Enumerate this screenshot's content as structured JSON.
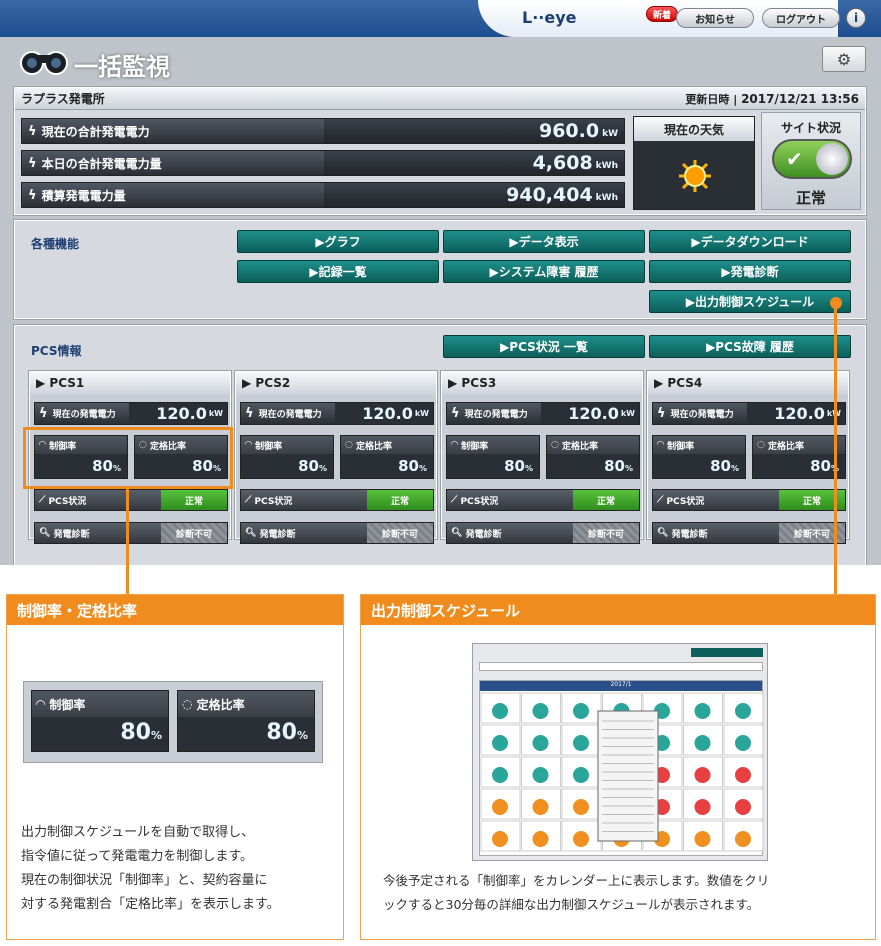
{
  "header": {
    "logo": "L··eye",
    "new_badge": "新着",
    "notice": "お知らせ",
    "logout": "ログアウト",
    "info": "i"
  },
  "page": {
    "title": "一括監視",
    "gear": "⚙"
  },
  "plant": {
    "name": "ラプラス発電所",
    "updated_label": "更新日時",
    "updated_value": "2017/12/21 13:56",
    "metrics": [
      {
        "label": "現在の合計発電電力",
        "value": "960.0",
        "unit": "kW"
      },
      {
        "label": "本日の合計発電電力量",
        "value": "4,608",
        "unit": "kWh"
      },
      {
        "label": "積算発電電力量",
        "value": "940,404",
        "unit": "kWh"
      }
    ],
    "weather_label": "現在の天気",
    "site_label": "サイト状況",
    "site_status": "正常"
  },
  "functions": {
    "label": "各種機能",
    "buttons": [
      "▶グラフ",
      "▶データ表示",
      "▶データダウンロード",
      "▶記録一覧",
      "▶システム障害 履歴",
      "▶発電診断",
      "▶出力制御スケジュール"
    ]
  },
  "pcs": {
    "label": "PCS情報",
    "btn_status": "▶PCS状況 一覧",
    "btn_fault": "▶PCS故障 履歴",
    "units": [
      {
        "name": "▶ PCS1",
        "power_label": "現在の発電電力",
        "power": "120.0",
        "unit": "kW",
        "ctrl_label": "制御率",
        "ctrl": "80",
        "rated_label": "定格比率",
        "rated": "80",
        "pct": "%",
        "status_label": "PCS状況",
        "status": "正常",
        "diag_label": "発電診断",
        "diag": "診断不可"
      },
      {
        "name": "▶ PCS2",
        "power_label": "現在の発電電力",
        "power": "120.0",
        "unit": "kW",
        "ctrl_label": "制御率",
        "ctrl": "80",
        "rated_label": "定格比率",
        "rated": "80",
        "pct": "%",
        "status_label": "PCS状況",
        "status": "正常",
        "diag_label": "発電診断",
        "diag": "診断不可"
      },
      {
        "name": "▶ PCS3",
        "power_label": "現在の発電電力",
        "power": "120.0",
        "unit": "kW",
        "ctrl_label": "制御率",
        "ctrl": "80",
        "rated_label": "定格比率",
        "rated": "80",
        "pct": "%",
        "status_label": "PCS状況",
        "status": "正常",
        "diag_label": "発電診断",
        "diag": "診断不可"
      },
      {
        "name": "▶ PCS4",
        "power_label": "現在の発電電力",
        "power": "120.0",
        "unit": "kW",
        "ctrl_label": "制御率",
        "ctrl": "80",
        "rated_label": "定格比率",
        "rated": "80",
        "pct": "%",
        "status_label": "PCS状況",
        "status": "正常",
        "diag_label": "発電診断",
        "diag": "診断不可"
      }
    ]
  },
  "callout1": {
    "title": "制御率・定格比率",
    "ctrl_label": "制御率",
    "ctrl": "80",
    "rated_label": "定格比率",
    "rated": "80",
    "pct": "%",
    "lines": [
      "出力制御スケジュールを自動で取得し、",
      "指令値に従って発電電力を制御します。",
      "現在の制御状況「制御率」と、契約容量に",
      "対する発電割合「定格比率」を表示します。"
    ]
  },
  "callout2": {
    "title": "出力制御スケジュール",
    "month": "2017/1",
    "lines": [
      "今後予定される「制御率」をカレンダー上に表示します。数値をクリ",
      "ックすると30分毎の詳細な出力制御スケジュールが表示されます。"
    ]
  }
}
